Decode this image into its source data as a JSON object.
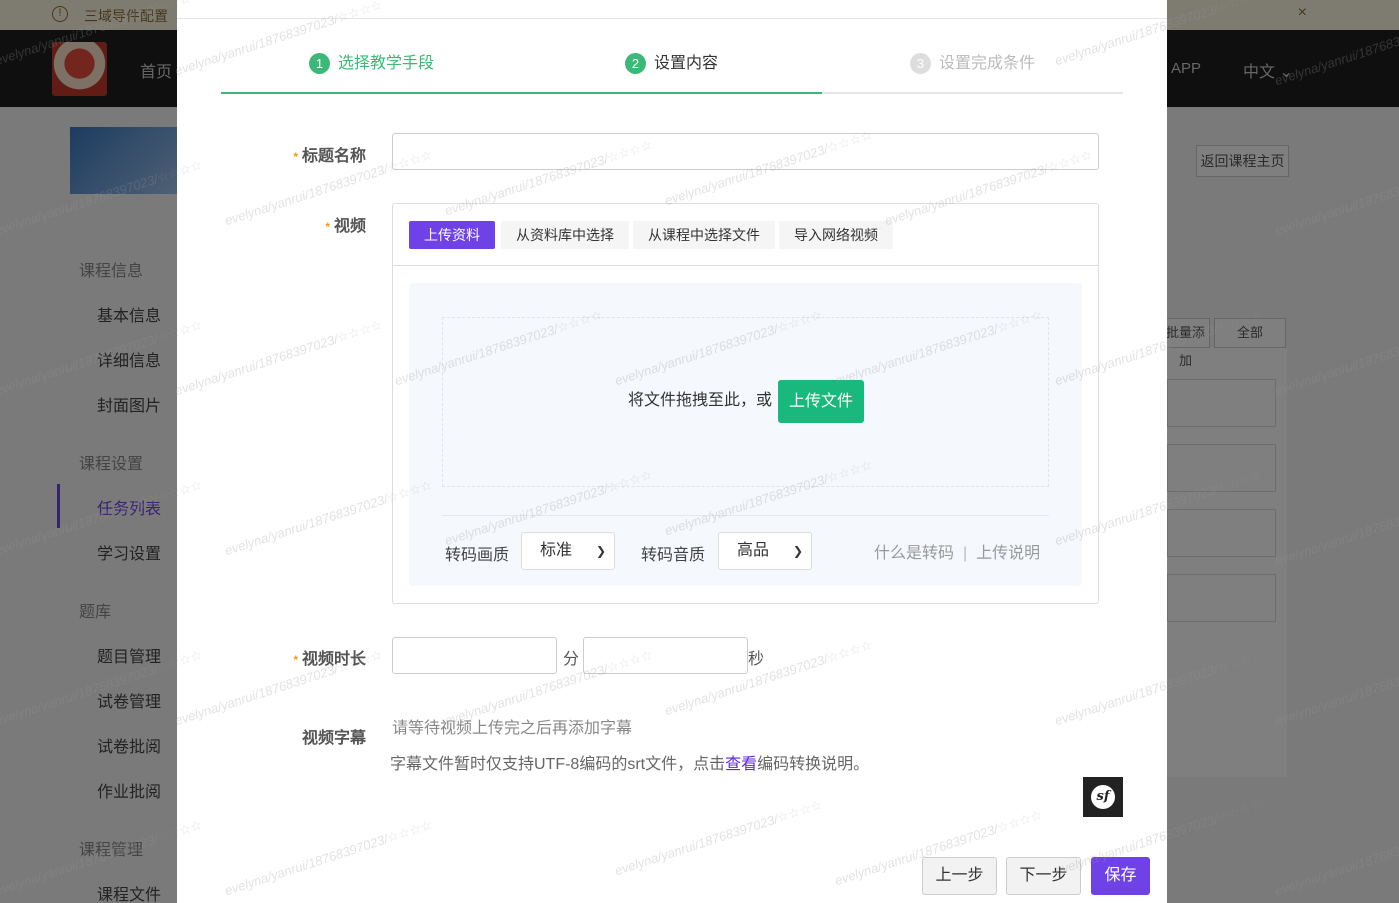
{
  "background": {
    "notice_text": "三域导件配置",
    "nav": {
      "home": "首页",
      "app": "APP",
      "lang": "中文"
    },
    "back_button": "返回课程主页",
    "sidebar": {
      "groups": [
        {
          "label": "课程信息",
          "items": [
            "基本信息",
            "详细信息",
            "封面图片"
          ]
        },
        {
          "label": "课程设置",
          "items": [
            "任务列表",
            "学习设置"
          ]
        },
        {
          "label": "题库",
          "items": [
            "题目管理",
            "试卷管理",
            "试卷批阅",
            "作业批阅"
          ]
        },
        {
          "label": "课程管理",
          "items": [
            "课程文件"
          ]
        }
      ]
    },
    "small_buttons": [
      "批量添加",
      "全部"
    ]
  },
  "steps": [
    {
      "num": "1",
      "label": "选择教学手段"
    },
    {
      "num": "2",
      "label": "设置内容"
    },
    {
      "num": "3",
      "label": "设置完成条件"
    }
  ],
  "form": {
    "title_label": "标题名称",
    "title_value": "",
    "video_label": "视频",
    "video_tabs": [
      "上传资料",
      "从资料库中选择",
      "从课程中选择文件",
      "导入网络视频"
    ],
    "drop_text": "将文件拖拽至此，或",
    "upload_button": "上传文件",
    "quality_label": "转码画质",
    "quality_value": "标准",
    "audio_label": "转码音质",
    "audio_value": "高品",
    "help_what": "什么是转码",
    "help_upload": "上传说明",
    "duration_label": "视频时长",
    "minute_unit": "分",
    "second_unit": "秒",
    "subtitle_label": "视频字幕",
    "subtitle_hint": "请等待视频上传完之后再添加字幕",
    "subtitle_note_prefix": "字幕文件暂时仅支持UTF-8编码的srt文件，点击",
    "subtitle_note_link": "查看",
    "subtitle_note_suffix": "编码转换说明。"
  },
  "footer": {
    "prev": "上一步",
    "next": "下一步",
    "save": "保存"
  },
  "watermark": "evelyna/yanrui/18768397023/☆☆☆☆",
  "colors": {
    "accent": "#6f42e8",
    "success": "#3cb878",
    "upload": "#19b87c"
  }
}
